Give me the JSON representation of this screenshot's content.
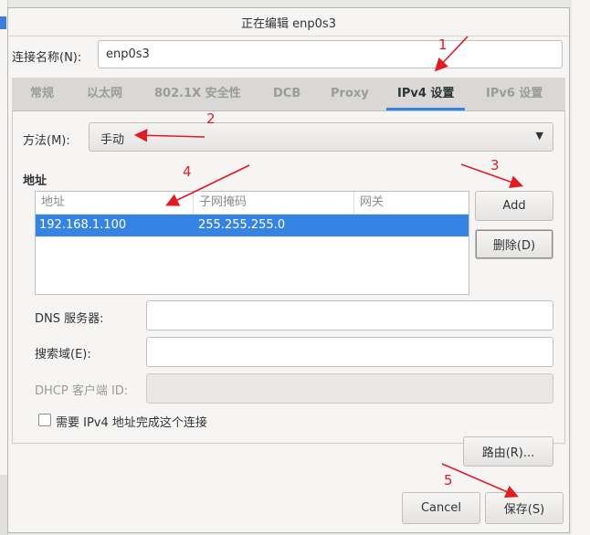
{
  "window": {
    "title": "正在编辑 enp0s3"
  },
  "connection": {
    "label": "连接名称(N):",
    "value": "enp0s3"
  },
  "tabs": [
    {
      "label": "常规"
    },
    {
      "label": "以太网"
    },
    {
      "label": "802.1X 安全性"
    },
    {
      "label": "DCB"
    },
    {
      "label": "Proxy"
    },
    {
      "label": "IPv4 设置",
      "active": true
    },
    {
      "label": "IPv6 设置"
    }
  ],
  "ipv4": {
    "method_label": "方法(M):",
    "method_value": "手动",
    "addresses_heading": "地址",
    "columns": [
      "地址",
      "子网掩码",
      "网关"
    ],
    "rows": [
      {
        "address": "192.168.1.100",
        "netmask": "255.255.255.0",
        "gateway": ""
      }
    ],
    "add_button": "Add",
    "delete_button": "删除(D)",
    "dns_label": "DNS 服务器:",
    "dns_value": "",
    "search_label": "搜索域(E):",
    "search_value": "",
    "dhcp_label": "DHCP 客户端 ID:",
    "dhcp_value": "",
    "require_label": "需要 IPv4 地址完成这个连接",
    "require_checked": false,
    "routes_button": "路由(R)..."
  },
  "footer": {
    "cancel_button": "Cancel",
    "save_button": "保存(S)"
  },
  "annotations": [
    "1",
    "2",
    "3",
    "4",
    "5"
  ],
  "colors": {
    "accent": "#3584e4",
    "annotation": "#e01b24"
  },
  "icons": {
    "dropdown": "chevron-down-icon",
    "checkbox": "checkbox-icon"
  }
}
